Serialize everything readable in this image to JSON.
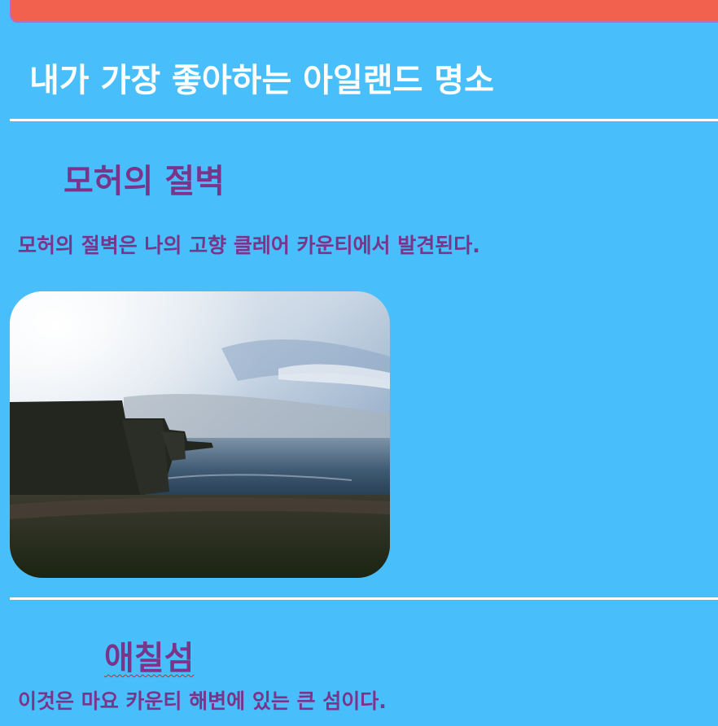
{
  "page": {
    "title": "내가 가장 좋아하는 아일랜드 명소"
  },
  "sections": [
    {
      "heading": "모허의 절벽",
      "text": "모허의 절벽은 나의 고향 클레어 카운티에서 발견된다."
    },
    {
      "heading": "애칠섬",
      "text": "이것은 마요 카운티 해변에 있는 큰 섬이다."
    }
  ],
  "colors": {
    "background": "#48BFFB",
    "banner": "#F2614D",
    "heading_text": "#7A3489",
    "title_text": "#FFFFFF",
    "divider": "#FFFFFF"
  }
}
